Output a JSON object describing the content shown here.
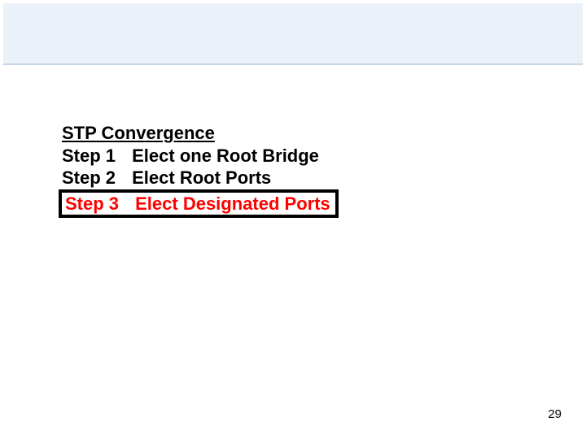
{
  "title": "STP Convergence",
  "steps": [
    {
      "label": "Step 1",
      "desc": "Elect one Root Bridge"
    },
    {
      "label": "Step 2",
      "desc": "Elect Root Ports"
    },
    {
      "label": "Step 3",
      "desc": "Elect Designated Ports"
    }
  ],
  "page_number": "29"
}
